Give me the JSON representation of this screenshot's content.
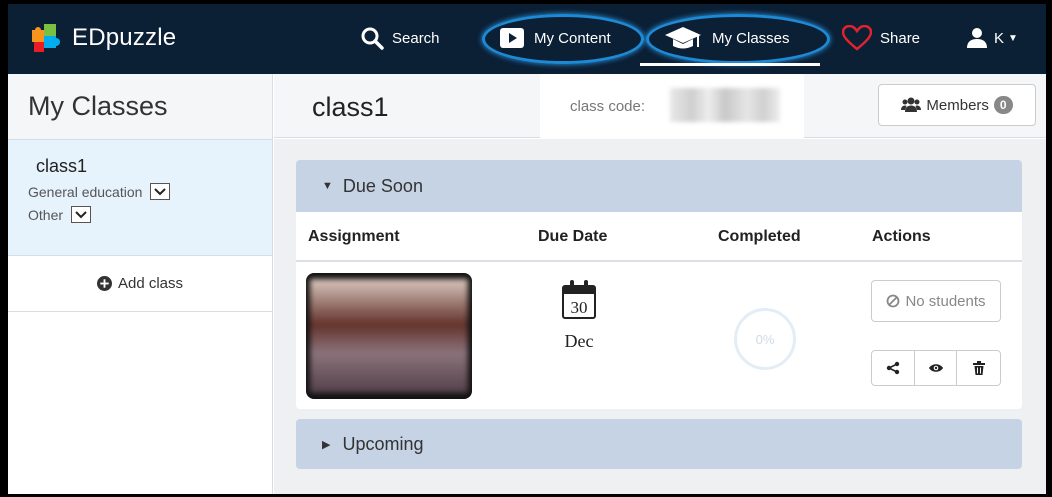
{
  "nav": {
    "brand": "EDpuzzle",
    "search": "Search",
    "my_content": "My Content",
    "my_classes": "My Classes",
    "share": "Share",
    "user_initial": "K"
  },
  "sidebar": {
    "title": "My Classes",
    "classes": [
      {
        "name": "class1",
        "category": "General education",
        "subcategory": "Other"
      }
    ],
    "add_class": "Add class"
  },
  "header": {
    "class_title": "class1",
    "code_label": "class code:",
    "members_label": "Members",
    "members_count": "0"
  },
  "due_soon": {
    "title": "Due Soon",
    "columns": [
      "Assignment",
      "Due Date",
      "Completed",
      "Actions"
    ],
    "rows": [
      {
        "due_day": "30",
        "due_month": "Dec",
        "completed": "0%",
        "status": "No students"
      }
    ]
  },
  "upcoming": {
    "title": "Upcoming"
  },
  "colors": {
    "nav_bg": "#0b1f35",
    "accent_ring": "#1e8ad6",
    "panel_head": "#c5d3e4",
    "selected_class": "#e6f2fc",
    "heart": "#e0232f"
  }
}
